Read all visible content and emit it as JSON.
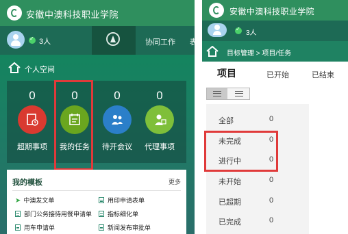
{
  "left": {
    "app_title": "安徽中澳科技职业学院",
    "online_count": "3人",
    "nav_collab": "协同工作",
    "nav_partial": "表",
    "space_label": "个人空间",
    "stats": [
      {
        "count": "0",
        "label": "超期事项",
        "color": "#d93a30",
        "icon": "overdue-icon"
      },
      {
        "count": "0",
        "label": "我的任务",
        "color": "#6aa61f",
        "icon": "task-icon"
      },
      {
        "count": "0",
        "label": "待开会议",
        "color": "#2b7fc9",
        "icon": "meeting-icon"
      },
      {
        "count": "0",
        "label": "代理事项",
        "color": "#7fbf3a",
        "icon": "proxy-icon"
      }
    ],
    "templates": {
      "title": "我的模板",
      "more": "更多",
      "items": [
        "中澳发文单",
        "用印申请表单",
        "部门公务接待用餐申请单",
        "指标细化单",
        "用车申请单",
        "新闻发布审批单"
      ]
    }
  },
  "right": {
    "app_title": "安徽中澳科技职业学院",
    "online_count": "3人",
    "breadcrumb": "目标管理 > 项目/任务",
    "tab_main": "项目",
    "tab_started": "已开始",
    "tab_ended": "已结束",
    "filters": [
      {
        "label": "全部",
        "value": "0"
      },
      {
        "label": "未完成",
        "value": "0"
      },
      {
        "label": "进行中",
        "value": "0"
      },
      {
        "label": "未开始",
        "value": "0"
      },
      {
        "label": "已超期",
        "value": "0"
      },
      {
        "label": "已完成",
        "value": "0"
      }
    ]
  },
  "colors": {
    "header_green": "#2f8f5e",
    "highlight_red": "#e03a3a"
  }
}
